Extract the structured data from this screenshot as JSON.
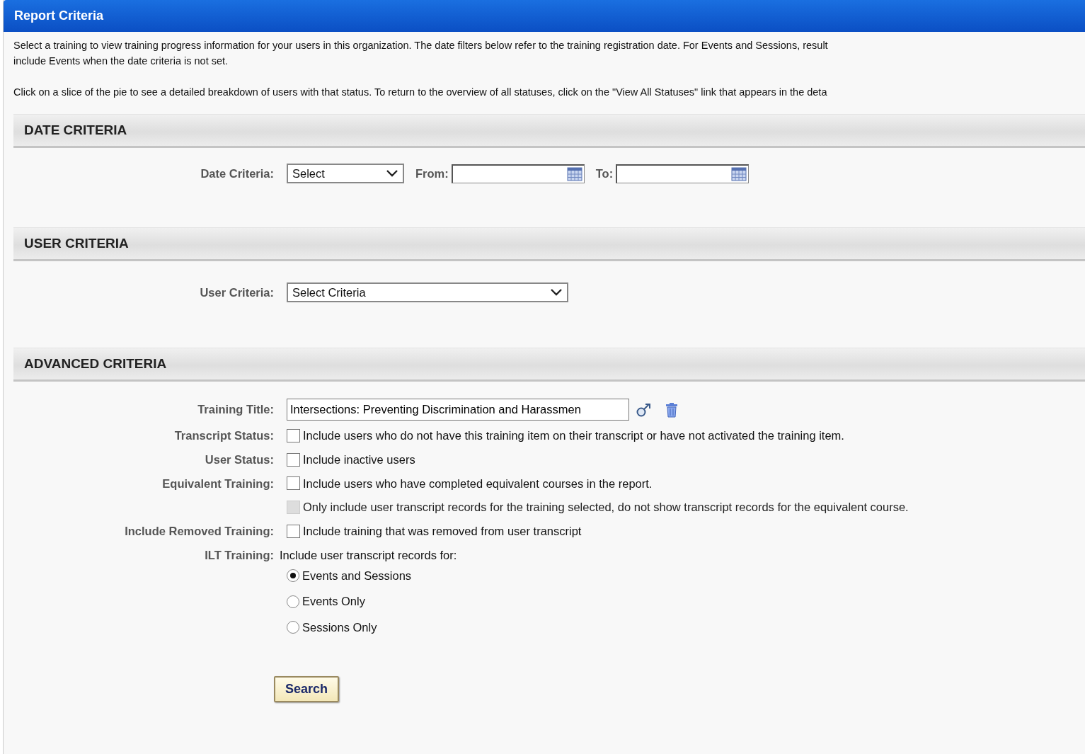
{
  "panel": {
    "title": "Report Criteria"
  },
  "intro": [
    "Select a training to view training progress information for your users in this organization. The date filters below refer to the training registration date. For Events and Sessions, result",
    "include Events when the date criteria is not set.",
    "Click on a slice of the pie to see a detailed breakdown of users with that status. To return to the overview of all statuses, click on the \"View All Statuses\" link that appears in the deta"
  ],
  "date_criteria": {
    "heading": "DATE CRITERIA",
    "label": "Date Criteria:",
    "select": "Select",
    "from_label": "From:",
    "to_label": "To:"
  },
  "user_criteria": {
    "heading": "USER CRITERIA",
    "label": "User Criteria:",
    "select": "Select Criteria"
  },
  "advanced_criteria": {
    "heading": "ADVANCED CRITERIA",
    "training_title": {
      "label": "Training Title:",
      "value": "Intersections: Preventing Discrimination and Harassmen"
    },
    "options": [
      {
        "label": "Transcript Status:",
        "text": "Include users who do not have this training item on their transcript or have not activated the training item.",
        "checked": false,
        "disabled": false
      },
      {
        "label": "User Status:",
        "text": "Include inactive users",
        "checked": false,
        "disabled": false
      },
      {
        "label": "Equivalent Training:",
        "text": "Include users who have completed equivalent courses in the report.",
        "checked": false,
        "disabled": false
      },
      {
        "text": "Only include user transcript records for the training selected, do not show transcript records for the equivalent course.",
        "checked": false,
        "disabled": true
      },
      {
        "label": "Include Removed Training:",
        "text": "Include training that was removed from user transcript",
        "checked": false,
        "disabled": false
      }
    ],
    "ilt": {
      "label": "ILT Training:",
      "text": "Include user transcript records for:",
      "choices": [
        {
          "label": "Events and Sessions",
          "selected": true
        },
        {
          "label": "Events Only",
          "selected": false
        },
        {
          "label": "Sessions Only",
          "selected": false
        }
      ]
    }
  },
  "search_button": "Search"
}
